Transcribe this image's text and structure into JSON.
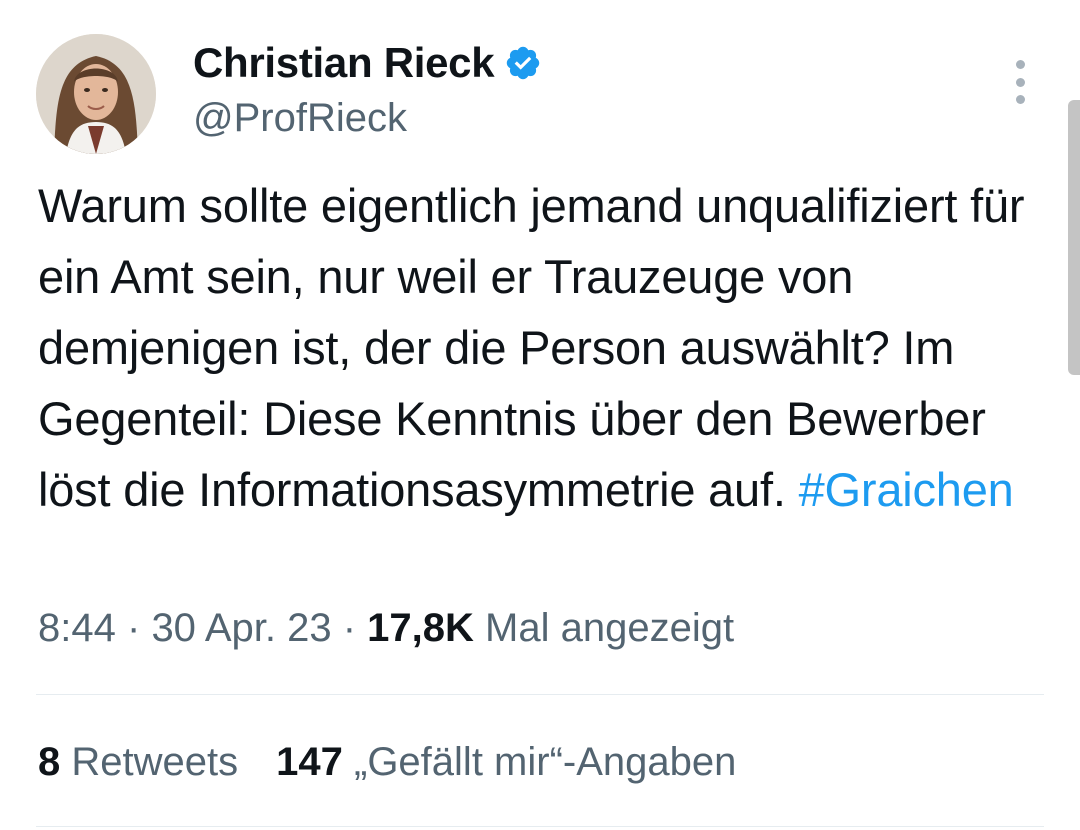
{
  "author": {
    "display_name": "Christian Rieck",
    "handle": "@ProfRieck",
    "verified": true
  },
  "tweet": {
    "text": "Warum sollte eigentlich jemand unqualifiziert für ein Amt sein, nur weil er Trauzeuge von demjenigen ist, der die Person auswählt? Im Gegenteil: Diese Kenntnis über den Bewerber löst die Informationsasymmetrie auf.",
    "hashtag": "#Graichen"
  },
  "meta": {
    "time": "8:44",
    "separator": "·",
    "date": "30 Apr. 23",
    "views_count": "17,8K",
    "views_label": "Mal angezeigt"
  },
  "stats": {
    "retweets_count": "8",
    "retweets_label": "Retweets",
    "likes_count": "147",
    "likes_label": "„Gefällt mir“-Angaben"
  },
  "colors": {
    "accent": "#1d9bf0",
    "text_primary": "#0f1419",
    "text_secondary": "#536471"
  },
  "icons": {
    "verified": "verified-badge-icon",
    "more": "more-vertical-icon"
  }
}
